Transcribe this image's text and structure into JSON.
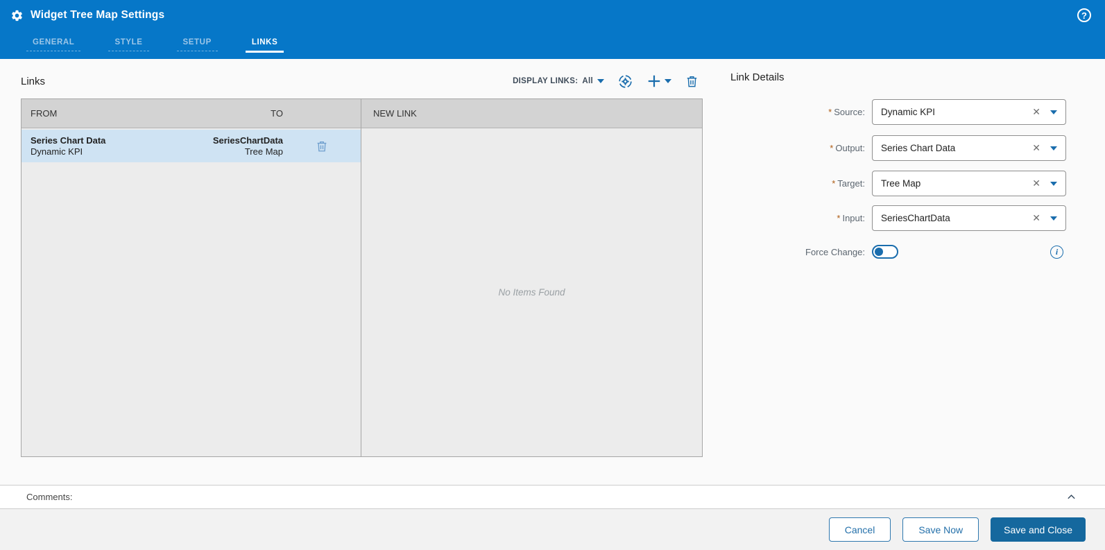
{
  "titlebar": {
    "title": "Widget Tree Map Settings"
  },
  "tabs": [
    {
      "label": "GENERAL",
      "active": false
    },
    {
      "label": "STYLE",
      "active": false
    },
    {
      "label": "SETUP",
      "active": false
    },
    {
      "label": "LINKS",
      "active": true
    }
  ],
  "links": {
    "title": "Links",
    "display_links_label": "DISPLAY LINKS:",
    "display_links_value": "All",
    "col_from": "FROM",
    "col_to": "TO",
    "col_new_link": "NEW LINK",
    "row": {
      "from_primary": "Series Chart Data",
      "from_secondary": "Dynamic KPI",
      "to_primary": "SeriesChartData",
      "to_secondary": "Tree Map"
    },
    "empty_text": "No Items Found"
  },
  "details": {
    "title": "Link Details",
    "required_marker": "*",
    "fields": [
      {
        "label": "Source:",
        "value": "Dynamic KPI"
      },
      {
        "label": "Output:",
        "value": "Series Chart Data"
      },
      {
        "label": "Target:",
        "value": "Tree Map"
      },
      {
        "label": "Input:",
        "value": "SeriesChartData"
      }
    ],
    "force_change_label": "Force Change:",
    "force_change_on": false
  },
  "comments": {
    "label": "Comments:"
  },
  "footer": {
    "cancel": "Cancel",
    "save_now": "Save Now",
    "save_and_close": "Save and Close"
  },
  "icons": {
    "help_glyph": "?",
    "clear_glyph": "✕",
    "info_glyph": "i"
  },
  "colors": {
    "header_blue": "#0677c8",
    "accent_blue": "#1a6dad",
    "primary_button_blue": "#15689e",
    "selected_row_blue": "#cfe3f3",
    "required_orange": "#ad5b13"
  }
}
